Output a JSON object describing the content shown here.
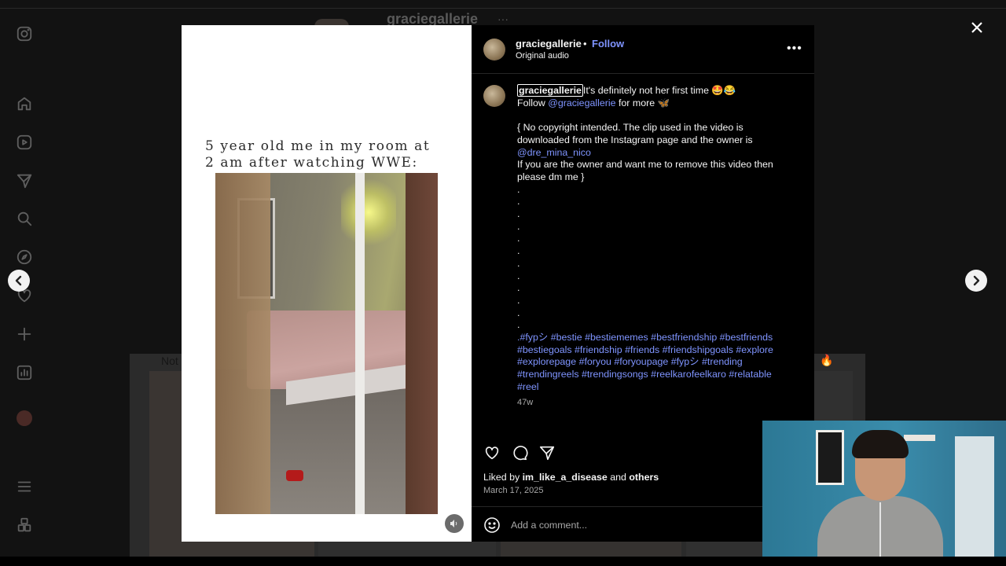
{
  "background": {
    "username": "graciegallerie",
    "dots": "···",
    "tile_label": "Not",
    "tile_emoji": "🔥"
  },
  "sidebar": {
    "items": [
      {
        "icon": "instagram-logo-icon"
      },
      {
        "icon": "home-icon"
      },
      {
        "icon": "reels-icon"
      },
      {
        "icon": "messages-icon"
      },
      {
        "icon": "search-icon"
      },
      {
        "icon": "explore-icon"
      },
      {
        "icon": "heart-icon"
      },
      {
        "icon": "create-icon"
      },
      {
        "icon": "dashboard-icon"
      },
      {
        "icon": "profile-avatar"
      },
      {
        "icon": "menu-icon"
      },
      {
        "icon": "also-from-meta-icon"
      }
    ]
  },
  "media": {
    "overlay_text_line1": "5 year old me in my room at",
    "overlay_text_line2": "2 am after watching WWE:"
  },
  "header": {
    "username": "graciegallerie",
    "separator": "•",
    "follow_label": "Follow",
    "audio": "Original audio",
    "more": "•••"
  },
  "caption": {
    "username": "graciegallerie",
    "line1": "It's definitely not her first time 🤩😂",
    "follow_prefix": "Follow ",
    "follow_handle": "@graciegallerie",
    "follow_suffix": " for more 🦋",
    "disclaimer1": "{ No copyright intended. The clip used in the video is downloaded from the Instagram page and the owner is",
    "owner_handle": "@dre_mina_nico",
    "disclaimer2": "If you are the owner and want me to remove this video then please dm me }",
    "dots": [
      ".",
      ".",
      ".",
      ".",
      ".",
      ".",
      ".",
      ".",
      ".",
      ".",
      ".",
      "."
    ],
    "hashtags": [
      ".#fypシ",
      "#bestie",
      "#bestiememes",
      "#bestfriendship",
      "#bestfriends",
      "#bestiegoals",
      "#friendship",
      "#friends",
      "#friendshipgoals",
      "#explore",
      "#explorepage",
      "#foryou",
      "#foryoupage",
      "#fypシ",
      "#trending",
      "#trendingreels",
      "#trendingsongs",
      "#reelkarofeelkaro",
      "#relatable",
      "#reel"
    ],
    "time_ago": "47w"
  },
  "engagement": {
    "liked_prefix": "Liked by ",
    "liked_user": "im_like_a_disease",
    "liked_and": " and ",
    "liked_others": "others",
    "date": "March 17, 2025"
  },
  "comment": {
    "placeholder": "Add a comment..."
  },
  "colors": {
    "accent_link": "#7f94ff",
    "panel_bg": "#000000",
    "text": "#f5f5f5",
    "muted": "#a8a8a8"
  }
}
